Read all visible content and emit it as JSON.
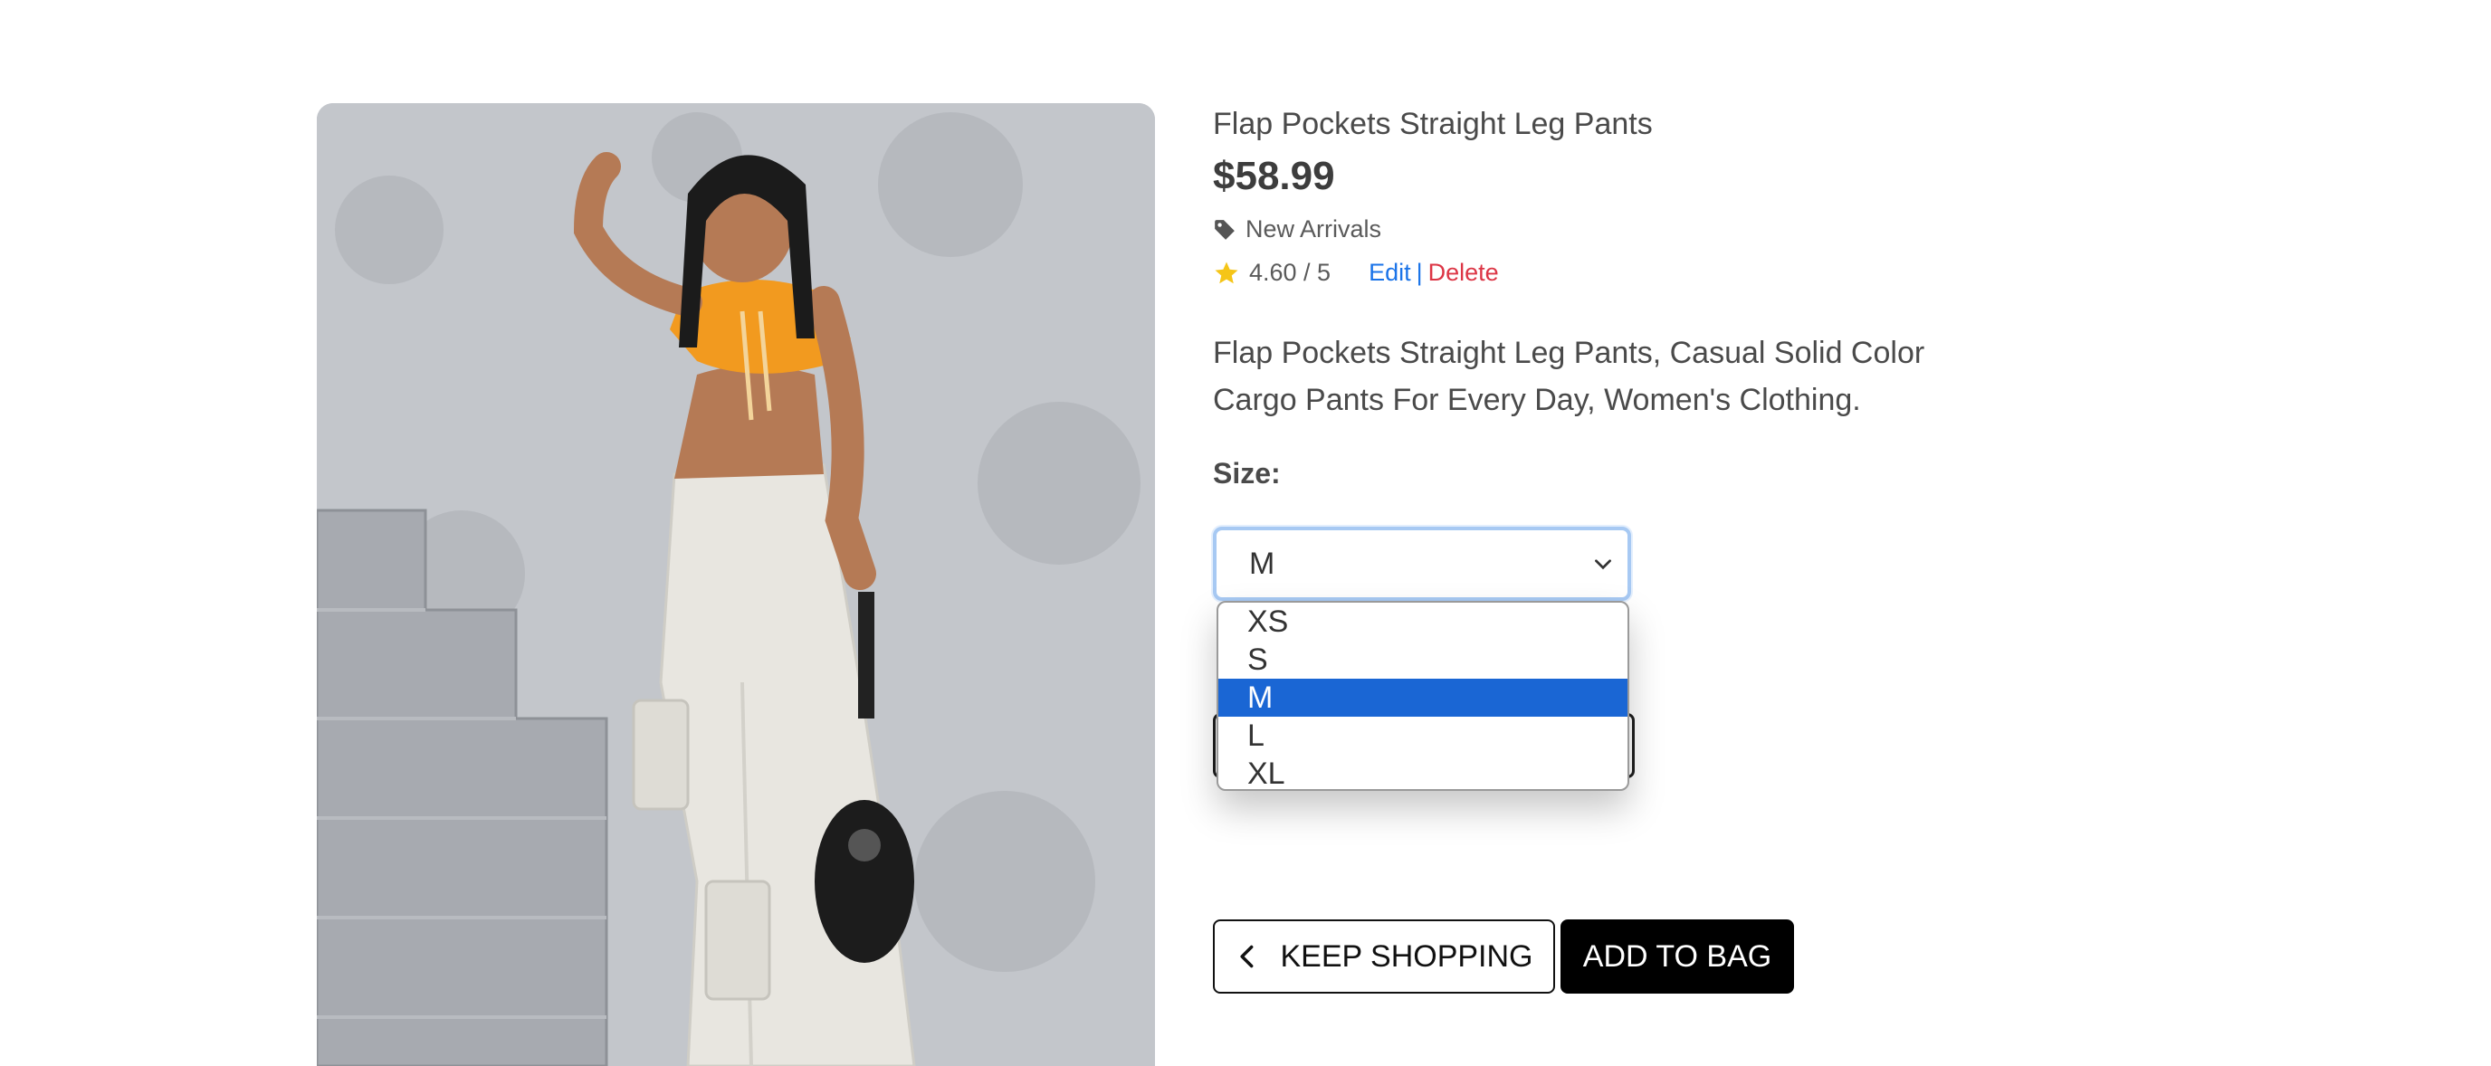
{
  "product": {
    "image_alt": "Model wearing flap pockets straight leg pants",
    "title": "Flap Pockets Straight Leg Pants",
    "price": "$58.99",
    "category": "New Arrivals",
    "rating": "4.60 / 5",
    "edit_label": "Edit",
    "separator": "|",
    "delete_label": "Delete",
    "description": "Flap Pockets Straight Leg Pants, Casual Solid Color Cargo Pants For Every Day, Women's Clothing."
  },
  "size": {
    "label": "Size:",
    "selected": "M",
    "options": [
      "XS",
      "S",
      "M",
      "L",
      "XL"
    ]
  },
  "actions": {
    "keep_shopping": "KEEP SHOPPING",
    "add_to_bag": "ADD TO BAG"
  },
  "icons": {
    "tag": "tag-icon",
    "star": "star-icon",
    "chevron_down": "chevron-down-icon",
    "chevron_left": "chevron-left-icon"
  },
  "colors": {
    "star": "#f5c518",
    "edit_link": "#1a73e8",
    "delete_link": "#dc3545",
    "selected_option": "#1a66d4",
    "primary_button": "#000000"
  }
}
